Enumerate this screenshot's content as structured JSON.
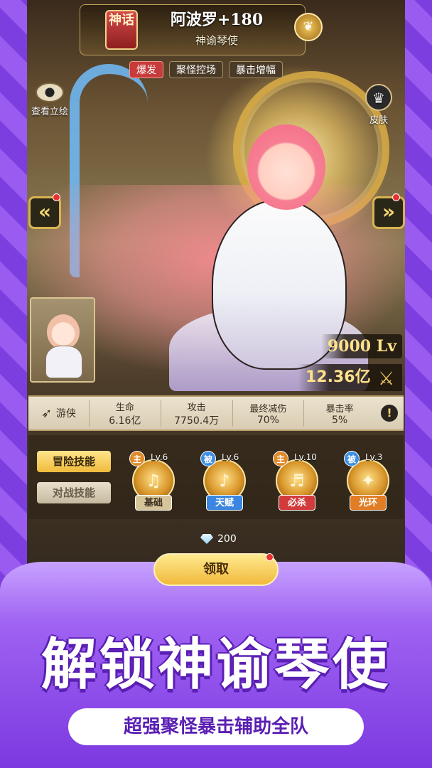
{
  "hero": {
    "rarity_badge": "神话",
    "name": "阿波罗+180",
    "title": "神谕琴使",
    "tags": [
      "爆发",
      "聚怪控场",
      "暴击增幅"
    ]
  },
  "controls": {
    "view_art_label": "查看立绘",
    "skin_label": "皮肤",
    "prev_arrow": "«",
    "next_arrow": "»"
  },
  "level": {
    "value": "9000",
    "unit": "Lv"
  },
  "power": "12.36亿",
  "stats": {
    "class": "游侠",
    "items": [
      {
        "label": "生命",
        "value": "6.16亿"
      },
      {
        "label": "攻击",
        "value": "7750.4万"
      },
      {
        "label": "最终减伤",
        "value": "70%"
      },
      {
        "label": "暴击率",
        "value": "5%"
      }
    ],
    "info_icon": "!"
  },
  "skill_tabs": [
    "冒险技能",
    "对战技能"
  ],
  "skills": [
    {
      "kind": "主",
      "level": "Lv.6",
      "name": "基础",
      "icon": "harp-icon"
    },
    {
      "kind": "被",
      "level": "Lv.6",
      "name": "天赋",
      "icon": "music-note-icon"
    },
    {
      "kind": "主",
      "level": "Lv.10",
      "name": "必杀",
      "icon": "music-burst-icon"
    },
    {
      "kind": "被",
      "level": "Lv.3",
      "name": "光环",
      "icon": "laurel-icon"
    }
  ],
  "reward": {
    "gem_amount": "200",
    "claim_label": "领取"
  },
  "promo": {
    "title": "解锁神谕琴使",
    "subtitle": "超强聚怪暴击辅助全队"
  },
  "colors": {
    "promo_purple": "#7c39e0",
    "gold": "#f0bb3c",
    "tag_red": "#c73b3b"
  }
}
